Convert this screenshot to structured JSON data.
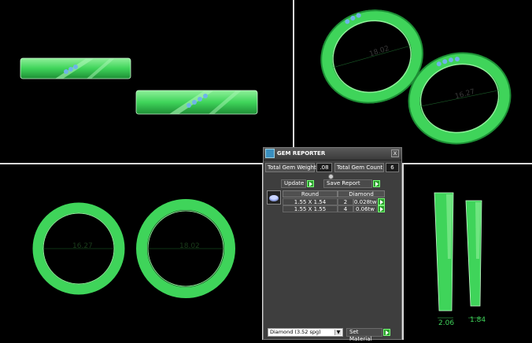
{
  "panel": {
    "title": "GEM REPORTER",
    "close_label": "x",
    "total_weight_label": "Total Gem Weight",
    "total_weight_value": ".08",
    "total_count_label": "Total Gem Count",
    "total_count_value": "6",
    "update_label": "Update",
    "save_report_label": "Save Report",
    "table": {
      "headers": [
        "Round",
        "Diamond"
      ],
      "rows": [
        {
          "size": "1.55 X 1.54",
          "count": "2",
          "weight": "0.028tw"
        },
        {
          "size": "1.55 X 1.55",
          "count": "4",
          "weight": "0.06tw"
        }
      ]
    },
    "material_select": "Diamond     (3.52 spg)",
    "set_material_label": "Set Material"
  },
  "dimensions": {
    "tr_ring_back": "18.02",
    "tr_ring_front": "16.27",
    "bl_ring_left": "16.27",
    "bl_ring_right": "18.02",
    "br_width_left": "2.06",
    "br_width_right": "1.84"
  },
  "colors": {
    "ring_green": "#3fd45a",
    "ring_dark": "#1f8a36",
    "gem_blue": "#6fb4e8",
    "button_green": "#2c9b2c"
  }
}
